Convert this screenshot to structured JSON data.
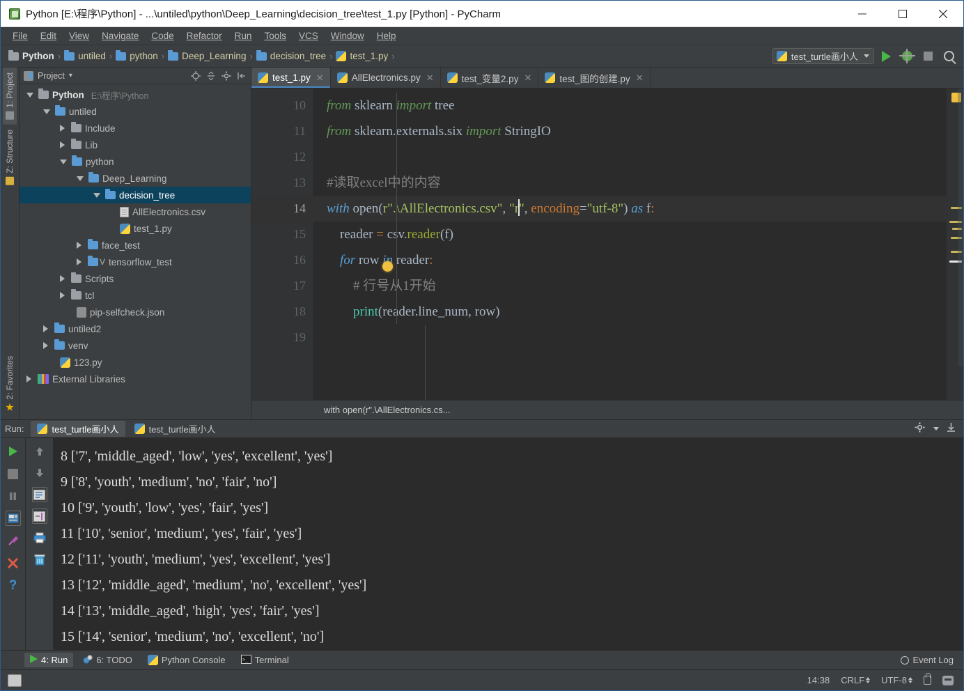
{
  "window": {
    "title": "Python [E:\\程序\\Python] - ...\\untiled\\python\\Deep_Learning\\decision_tree\\test_1.py [Python] - PyCharm",
    "minimize": "–",
    "maximize": "□",
    "close": "✕"
  },
  "menubar": [
    {
      "label": "File"
    },
    {
      "label": "Edit"
    },
    {
      "label": "View"
    },
    {
      "label": "Navigate"
    },
    {
      "label": "Code"
    },
    {
      "label": "Refactor"
    },
    {
      "label": "Run"
    },
    {
      "label": "Tools"
    },
    {
      "label": "VCS"
    },
    {
      "label": "Window"
    },
    {
      "label": "Help"
    }
  ],
  "navbar": {
    "crumbs": [
      {
        "label": "Python",
        "icon": "folder-icon"
      },
      {
        "label": "untiled",
        "icon": "folder-icon"
      },
      {
        "label": "python",
        "icon": "folder-icon"
      },
      {
        "label": "Deep_Learning",
        "icon": "folder-icon"
      },
      {
        "label": "decision_tree",
        "icon": "folder-icon"
      },
      {
        "label": "test_1.py",
        "icon": "python-file-icon"
      }
    ],
    "separator": "›",
    "run_config": "test_turtle画小人",
    "buttons": [
      "run-button",
      "debug-button",
      "stop-button",
      "search-everywhere-button"
    ]
  },
  "left_strip": {
    "tabs": [
      {
        "label": "1: Project",
        "active": true
      },
      {
        "label": "Z: Structure",
        "active": false
      }
    ],
    "bottom_tabs": [
      {
        "label": "2: Favorites",
        "active": false
      }
    ]
  },
  "project_panel": {
    "header": {
      "title": "Project",
      "caret": "▾"
    },
    "tree": [
      {
        "depth": 0,
        "arrow": "down",
        "icon": "folder-grey-icon",
        "label": "Python",
        "sub": "E:\\程序\\Python",
        "bold": true,
        "selected": false
      },
      {
        "depth": 1,
        "arrow": "down",
        "icon": "folder-blue-icon",
        "label": "untiled",
        "sub": "",
        "bold": false,
        "selected": false
      },
      {
        "depth": 2,
        "arrow": "right",
        "icon": "folder-grey-icon",
        "label": "Include",
        "sub": "",
        "bold": false,
        "selected": false
      },
      {
        "depth": 2,
        "arrow": "right",
        "icon": "folder-grey-icon",
        "label": "Lib",
        "sub": "",
        "bold": false,
        "selected": false
      },
      {
        "depth": 2,
        "arrow": "down",
        "icon": "folder-blue-icon",
        "label": "python",
        "sub": "",
        "bold": false,
        "selected": false
      },
      {
        "depth": 3,
        "arrow": "down",
        "icon": "folder-blue-icon",
        "label": "Deep_Learning",
        "sub": "",
        "bold": false,
        "selected": false
      },
      {
        "depth": 4,
        "arrow": "down",
        "icon": "folder-blue-icon",
        "label": "decision_tree",
        "sub": "",
        "bold": false,
        "selected": true
      },
      {
        "depth": 5,
        "arrow": "none",
        "icon": "csv-file-icon",
        "label": "AllElectronics.csv",
        "sub": "",
        "bold": false,
        "selected": false
      },
      {
        "depth": 5,
        "arrow": "none",
        "icon": "python-file-icon",
        "label": "test_1.py",
        "sub": "",
        "bold": false,
        "selected": false
      },
      {
        "depth": 3,
        "arrow": "right",
        "icon": "folder-blue-icon",
        "label": "face_test",
        "sub": "",
        "bold": false,
        "selected": false
      },
      {
        "depth": 3,
        "arrow": "right",
        "icon": "folder-blue-vcs-icon",
        "label": "tensorflow_test",
        "sub": "",
        "bold": false,
        "selected": false
      },
      {
        "depth": 2,
        "arrow": "right",
        "icon": "folder-grey-icon",
        "label": "Scripts",
        "sub": "",
        "bold": false,
        "selected": false
      },
      {
        "depth": 2,
        "arrow": "right",
        "icon": "folder-grey-icon",
        "label": "tcl",
        "sub": "",
        "bold": false,
        "selected": false
      },
      {
        "depth": 2,
        "arrow": "none",
        "icon": "json-file-icon",
        "label": "pip-selfcheck.json",
        "sub": "",
        "bold": false,
        "selected": false
      },
      {
        "depth": 1,
        "arrow": "right",
        "icon": "folder-blue-icon",
        "label": "untiled2",
        "sub": "",
        "bold": false,
        "selected": false
      },
      {
        "depth": 1,
        "arrow": "right",
        "icon": "folder-blue-icon",
        "label": "venv",
        "sub": "",
        "bold": false,
        "selected": false
      },
      {
        "depth": 1,
        "arrow": "none",
        "icon": "python-file-icon",
        "label": "123.py",
        "sub": "",
        "bold": false,
        "selected": false
      },
      {
        "depth": 0,
        "arrow": "right",
        "icon": "external-libraries-icon",
        "label": "External Libraries",
        "sub": "",
        "bold": false,
        "selected": false
      }
    ]
  },
  "editor": {
    "tabs": [
      {
        "label": "test_1.py",
        "active": true,
        "close": "✕"
      },
      {
        "label": "AllElectronics.py",
        "active": false,
        "close": "✕"
      },
      {
        "label": "test_变量2.py",
        "active": false,
        "close": "✕"
      },
      {
        "label": "test_图的创建.py",
        "active": false,
        "close": "✕"
      }
    ],
    "line_numbers": [
      "10",
      "11",
      "12",
      "13",
      "14",
      "15",
      "16",
      "17",
      "18",
      "19"
    ],
    "current_line": "14",
    "code_lines": [
      "from sklearn import tree",
      "from sklearn.externals.six import StringIO",
      "",
      "#读取excel中的内容",
      "with open(r\".\\AllElectronics.csv\", \"r\", encoding=\"utf-8\") as f:",
      "    reader = csv.reader(f)",
      "    for row in reader:",
      "        # 行号从1开始",
      "        print(reader.line_num, row)",
      ""
    ],
    "breadcrumb": "with open(r\".\\AllElectronics.cs..."
  },
  "run_panel": {
    "label": "Run:",
    "tabs": [
      {
        "label": "test_turtle画小人",
        "active": true
      },
      {
        "label": "test_turtle画小人",
        "active": false
      }
    ],
    "console_lines": [
      "8 ['7', 'middle_aged', 'low', 'yes', 'excellent', 'yes']",
      "9 ['8', 'youth', 'medium', 'no', 'fair', 'no']",
      "10 ['9', 'youth', 'low', 'yes', 'fair', 'yes']",
      "11 ['10', 'senior', 'medium', 'yes', 'fair', 'yes']",
      "12 ['11', 'youth', 'medium', 'yes', 'excellent', 'yes']",
      "13 ['12', 'middle_aged', 'medium', 'no', 'excellent', 'yes']",
      "14 ['13', 'middle_aged', 'high', 'yes', 'fair', 'yes']",
      "15 ['14', 'senior', 'medium', 'no', 'excellent', 'no']"
    ],
    "side_buttons": [
      "rerun-button",
      "stop-button",
      "pause-button",
      "console-button",
      "pin-button",
      "close-button",
      "help-button"
    ],
    "side_buttons2": [
      "scroll-up-button",
      "scroll-down-button",
      "soft-wrap-button",
      "scroll-to-end-button",
      "print-button",
      "clear-all-button"
    ]
  },
  "bottom_bar": {
    "items": [
      {
        "label": "4: Run",
        "icon": "run-icon",
        "active": true
      },
      {
        "label": "6: TODO",
        "icon": "todo-icon",
        "active": false
      },
      {
        "label": "Python Console",
        "icon": "python-console-icon",
        "active": false
      },
      {
        "label": "Terminal",
        "icon": "terminal-icon",
        "active": false
      }
    ],
    "event_log": "Event Log"
  },
  "statusbar": {
    "time": "14:38",
    "line_separator": "CRLF",
    "encoding": "UTF-8",
    "lock": "lock-icon",
    "bot": "bot-icon"
  },
  "colors": {
    "accent": "#4a88c7",
    "selection": "#0d425d",
    "editor_bg": "#2b2b2b",
    "panel_bg": "#3c3f41",
    "run_green": "#48b748"
  }
}
